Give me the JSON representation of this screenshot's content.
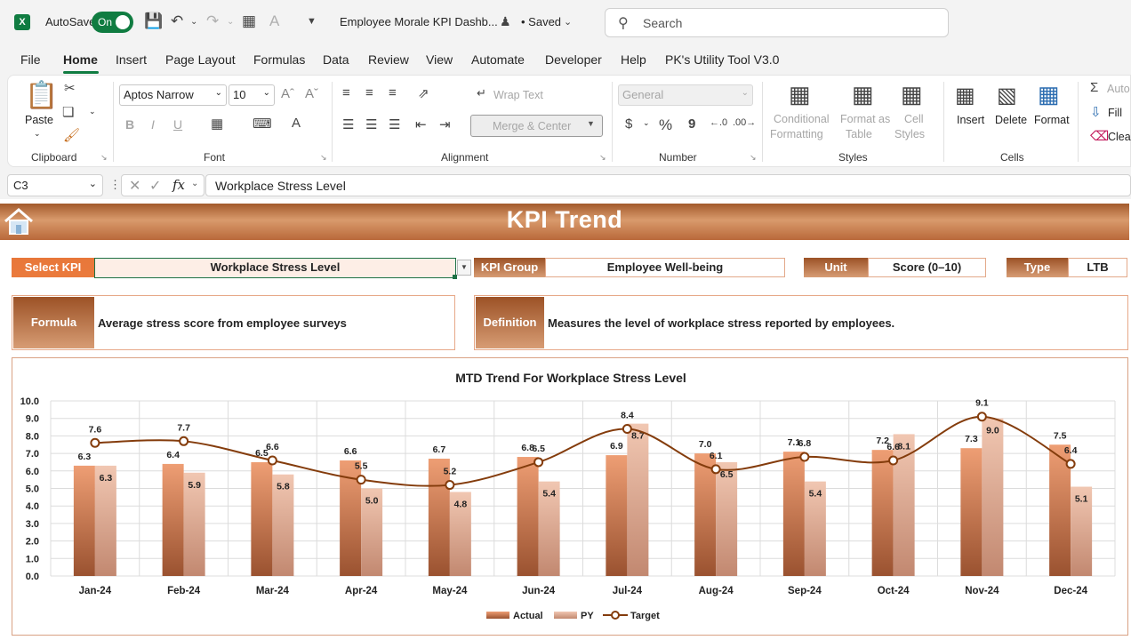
{
  "titlebar": {
    "app_logo": "X",
    "autosave_label": "AutoSave",
    "autosave_state": "On",
    "doc_title": "Employee Morale KPI Dashb...",
    "saved_state": "• Saved",
    "search_placeholder": "Search"
  },
  "menu": {
    "tabs": [
      "File",
      "Home",
      "Insert",
      "Page Layout",
      "Formulas",
      "Data",
      "Review",
      "View",
      "Automate",
      "Developer",
      "Help",
      "PK's Utility Tool V3.0"
    ],
    "active": "Home"
  },
  "ribbon": {
    "clipboard": {
      "paste": "Paste",
      "label": "Clipboard"
    },
    "font": {
      "name": "Aptos Narrow",
      "size": "10",
      "label": "Font",
      "bold": "B",
      "italic": "I",
      "underline": "U"
    },
    "alignment": {
      "wrap_text": "Wrap Text",
      "merge_center": "Merge & Center",
      "label": "Alignment"
    },
    "number": {
      "format": "General",
      "currency": "$",
      "percent": "%",
      "comma": "9",
      "label": "Number"
    },
    "styles": {
      "conditional_1": "Conditional",
      "conditional_2": "Formatting",
      "format_table_1": "Format as",
      "format_table_2": "Table",
      "cell_styles_1": "Cell",
      "cell_styles_2": "Styles",
      "label": "Styles"
    },
    "cells": {
      "insert": "Insert",
      "delete": "Delete",
      "format": "Format",
      "label": "Cells"
    },
    "editing": {
      "autosum": "Auto",
      "fill": "Fill",
      "clear": "Clea"
    }
  },
  "formula_bar": {
    "name_box": "C3",
    "fx": "fx",
    "formula": "Workplace Stress Level"
  },
  "dashboard": {
    "title": "KPI Trend",
    "select_kpi_label": "Select KPI",
    "select_kpi_value": "Workplace Stress Level",
    "kpi_group_label": "KPI Group",
    "kpi_group_value": "Employee Well-being",
    "unit_label": "Unit",
    "unit_value": "Score (0–10)",
    "type_label": "Type",
    "type_value": "LTB",
    "formula_label": "Formula",
    "formula_value": "Average stress score from employee surveys",
    "definition_label": "Definition",
    "definition_value": "Measures the level of workplace stress reported by employees."
  },
  "colors": {
    "accent_green": "#107c41",
    "banner_brown": "#a35a2c",
    "label_orange": "#e8773a",
    "actual_bar": "#c97a50",
    "py_bar": "#e3b39a",
    "target_line": "#843c0c"
  },
  "chart_data": {
    "type": "bar",
    "title": "MTD Trend For Workplace Stress Level",
    "categories": [
      "Jan-24",
      "Feb-24",
      "Mar-24",
      "Apr-24",
      "May-24",
      "Jun-24",
      "Jul-24",
      "Aug-24",
      "Sep-24",
      "Oct-24",
      "Nov-24",
      "Dec-24"
    ],
    "series": [
      {
        "name": "Actual",
        "type": "bar",
        "values": [
          6.3,
          6.4,
          6.5,
          6.6,
          6.7,
          6.8,
          6.9,
          7.0,
          7.1,
          7.2,
          7.3,
          7.5
        ]
      },
      {
        "name": "PY",
        "type": "bar",
        "values": [
          6.3,
          5.9,
          5.8,
          5.0,
          4.8,
          5.4,
          8.7,
          6.5,
          5.4,
          8.1,
          9.0,
          5.1
        ]
      },
      {
        "name": "Target",
        "type": "line",
        "values": [
          7.6,
          7.7,
          6.6,
          5.5,
          5.2,
          6.5,
          8.4,
          6.1,
          6.8,
          6.6,
          9.1,
          6.4
        ]
      }
    ],
    "ylim": [
      0,
      10
    ],
    "yticks": [
      "0.0",
      "1.0",
      "2.0",
      "3.0",
      "4.0",
      "5.0",
      "6.0",
      "7.0",
      "8.0",
      "9.0",
      "10.0"
    ],
    "grid": true,
    "legend": "bottom"
  }
}
